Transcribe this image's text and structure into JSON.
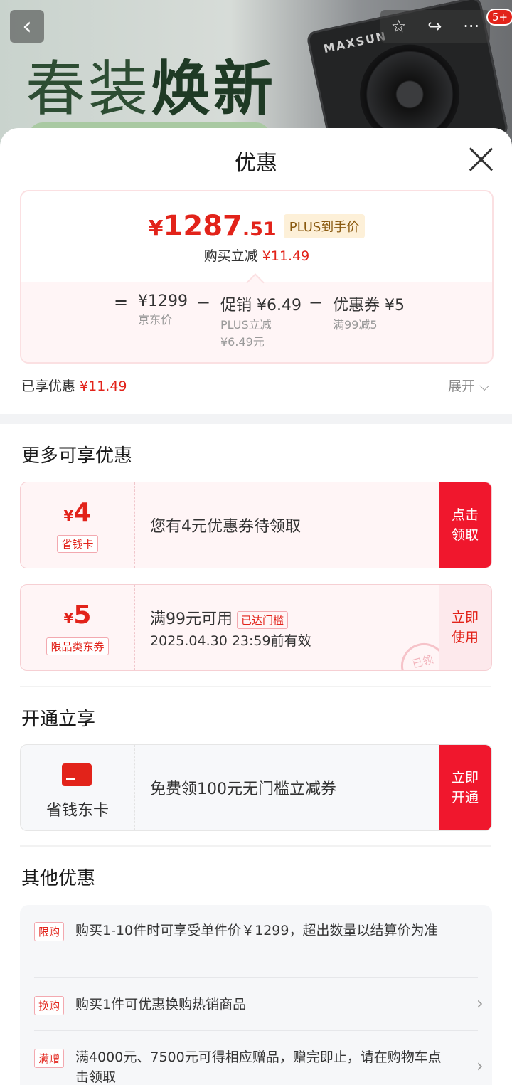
{
  "background": {
    "title_light": "春装",
    "title_bold": "焕新",
    "gpu_brand": "MAXSUN",
    "badge": "5+"
  },
  "icons": {
    "back": "‹",
    "star": "☆",
    "share": "↪",
    "more": "···"
  },
  "sheet": {
    "title": "优惠"
  },
  "price": {
    "yen": "¥",
    "integer": "1287",
    "decimal": ".51",
    "plus_tag": "PLUS到手价",
    "save_label": "购买立减",
    "save_amount": "¥11.49",
    "formula": {
      "eq": "=",
      "base_value": "¥1299",
      "base_label": "京东价",
      "minus1": "−",
      "promo_value": "促销 ¥6.49",
      "promo_sub1": "PLUS立减",
      "promo_sub2": "¥6.49元",
      "minus2": "−",
      "coupon_value": "优惠券 ¥5",
      "coupon_sub": "满99减5"
    }
  },
  "applied": {
    "label": "已享优惠",
    "amount": "¥11.49",
    "expand": "展开 ⌵"
  },
  "more_deals": {
    "title": "更多可享优惠",
    "coupon1": {
      "yen": "¥",
      "amount": "4",
      "tag": "省钱卡",
      "text": "您有4元优惠券待领取",
      "button_line1": "点击",
      "button_line2": "领取"
    },
    "coupon2": {
      "yen": "¥",
      "amount": "5",
      "tag": "限品类东券",
      "condition": "满99元可用",
      "threshold_tag": "已达门槛",
      "expiry": "2025.04.30 23:59前有效",
      "stamp": "已领",
      "button_line1": "立即",
      "button_line2": "使用"
    }
  },
  "open_benefit": {
    "title": "开通立享",
    "card_name": "省钱东卡",
    "text": "免费领100元无门槛立减券",
    "button_line1": "立即",
    "button_line2": "开通"
  },
  "other": {
    "title": "其他优惠",
    "rows": [
      {
        "tag": "限购",
        "text": "购买1-10件时可享受单件价￥1299，超出数量以结算价为准"
      },
      {
        "tag": "换购",
        "text": "购买1件可优惠换购热销商品",
        "arrow": "›"
      },
      {
        "tag": "满赠",
        "text": "满4000元、7500元可得相应赠品，赠完即止，请在购物车点击领取",
        "arrow": "›"
      }
    ]
  },
  "colors": {
    "accent_red": "#e2231a",
    "button_red": "#f0172d",
    "coupon_bg": "#fff5f6",
    "plus_gold_bg": "#fdf0d8"
  }
}
